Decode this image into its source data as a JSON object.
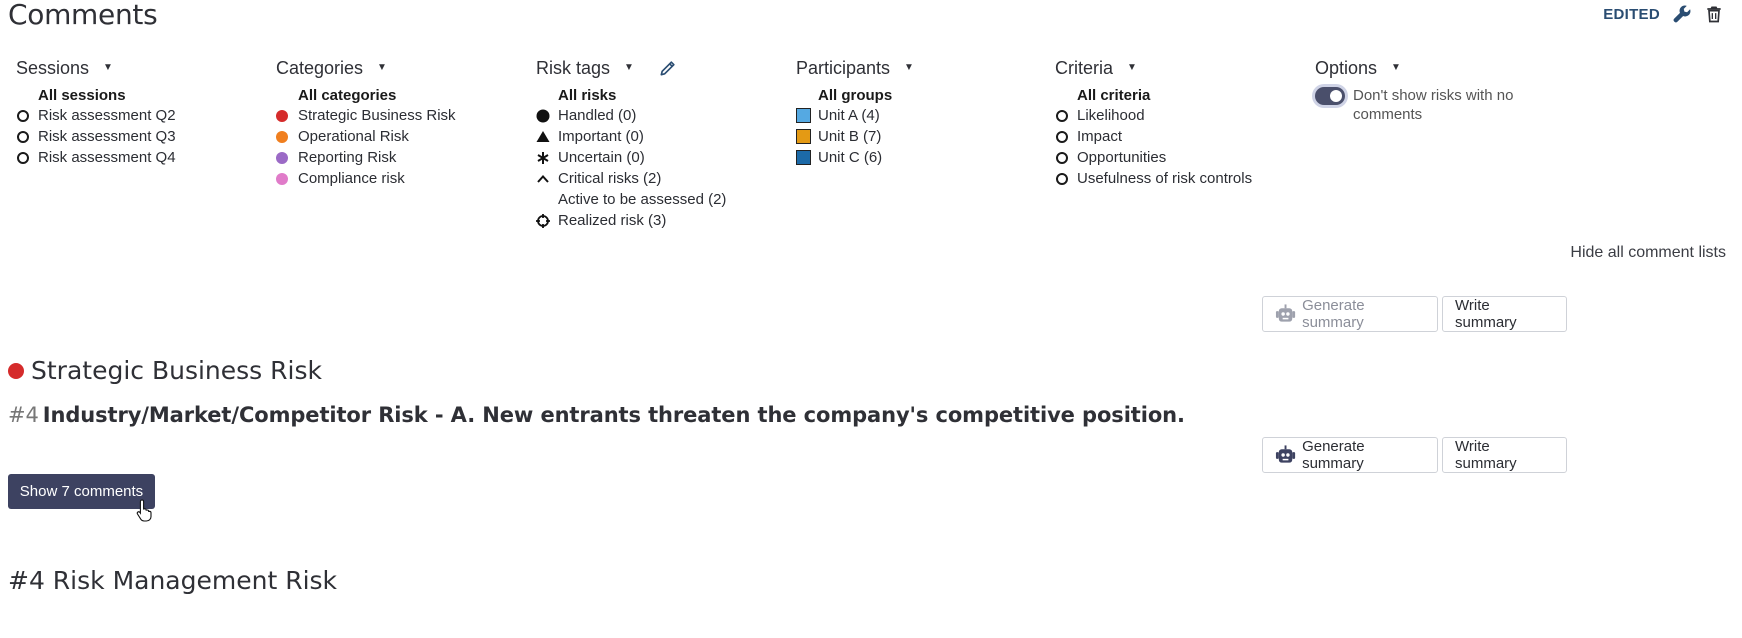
{
  "page": {
    "title": "Comments",
    "status": "EDITED",
    "icons": [
      "wrench-icon",
      "trash-icon"
    ]
  },
  "filters": {
    "sessions": {
      "label": "Sessions",
      "all": "All sessions",
      "items": [
        "Risk assessment Q2",
        "Risk assessment Q3",
        "Risk assessment Q4"
      ]
    },
    "categories": {
      "label": "Categories",
      "all": "All categories",
      "items": [
        {
          "label": "Strategic Business Risk",
          "color": "#d52b2b"
        },
        {
          "label": "Operational Risk",
          "color": "#f07f1f"
        },
        {
          "label": "Reporting Risk",
          "color": "#9b6ac6"
        },
        {
          "label": "Compliance risk",
          "color": "#e07bc9"
        }
      ]
    },
    "risk_tags": {
      "label": "Risk tags",
      "all": "All risks",
      "items": [
        {
          "label": "Handled (0)",
          "icon": "filled-circle-icon"
        },
        {
          "label": "Important (0)",
          "icon": "triangle-icon"
        },
        {
          "label": "Uncertain (0)",
          "icon": "asterisk-icon"
        },
        {
          "label": "Critical risks (2)",
          "icon": "caret-up-icon"
        },
        {
          "label": "Active to be assessed (2)",
          "icon": ""
        },
        {
          "label": "Realized risk (3)",
          "icon": "crosshair-icon"
        }
      ]
    },
    "participants": {
      "label": "Participants",
      "all": "All groups",
      "items": [
        {
          "label": "Unit A (4)",
          "color": "#55a9e2"
        },
        {
          "label": "Unit B (7)",
          "color": "#e49a14"
        },
        {
          "label": "Unit C (6)",
          "color": "#1c6aa8"
        }
      ]
    },
    "criteria": {
      "label": "Criteria",
      "all": "All criteria",
      "items": [
        "Likelihood",
        "Impact",
        "Opportunities",
        "Usefulness of risk controls"
      ]
    },
    "options": {
      "label": "Options",
      "toggle_label": "Don't show risks with no comments",
      "toggle_on": true
    }
  },
  "hide_all_label": "Hide all comment lists",
  "summary_buttons": {
    "generate": "Generate summary",
    "write": "Write summary"
  },
  "category_section": {
    "title": "Strategic Business Risk",
    "color": "#d52b2b"
  },
  "risk": {
    "number": "#4",
    "title": "Industry/Market/Competitor Risk - A. New entrants threaten the company's competitive position.",
    "show_comments": "Show 7 comments"
  },
  "next_section_title": "#4 Risk Management Risk"
}
